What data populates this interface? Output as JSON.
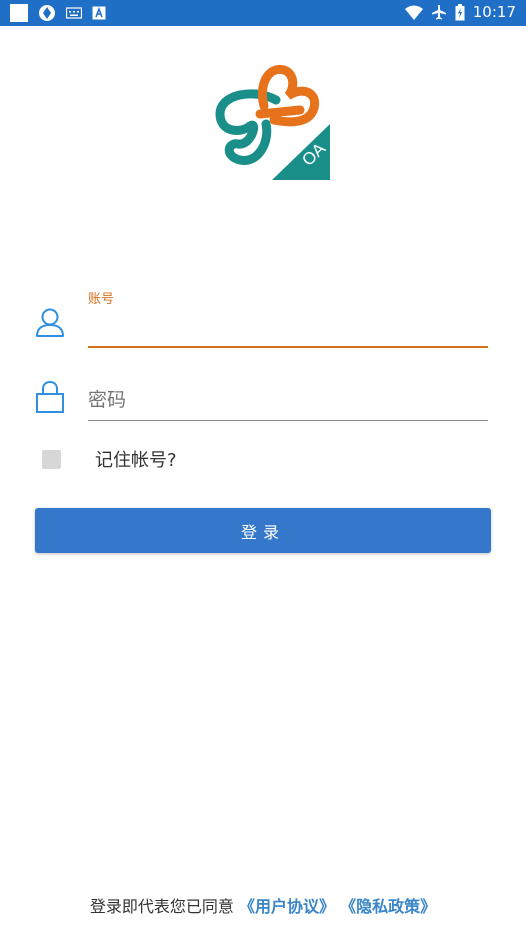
{
  "status_bar": {
    "time": "10:17",
    "icons": [
      "app-square-icon",
      "vpn-icon",
      "keyboard-icon",
      "a-box-icon",
      "wifi-icon",
      "airplane-icon",
      "battery-icon"
    ]
  },
  "colors": {
    "status_bar_bg": "#1f6fc6",
    "accent_orange": "#d4701c",
    "accent_teal": "#1a8f8a",
    "button_bg": "#3578cb",
    "link_blue": "#3a86c8",
    "icon_blue": "#2f8fe0"
  },
  "logo": {
    "badge_text": "OA"
  },
  "form": {
    "account_label": "账号",
    "account_value": "",
    "password_placeholder": "密码",
    "remember_label": "记住帐号?",
    "remember_checked": false,
    "login_button": "登录"
  },
  "footer": {
    "prefix": "登录即代表您已同意",
    "user_agreement": "《用户协议》",
    "privacy_policy": "《隐私政策》"
  }
}
